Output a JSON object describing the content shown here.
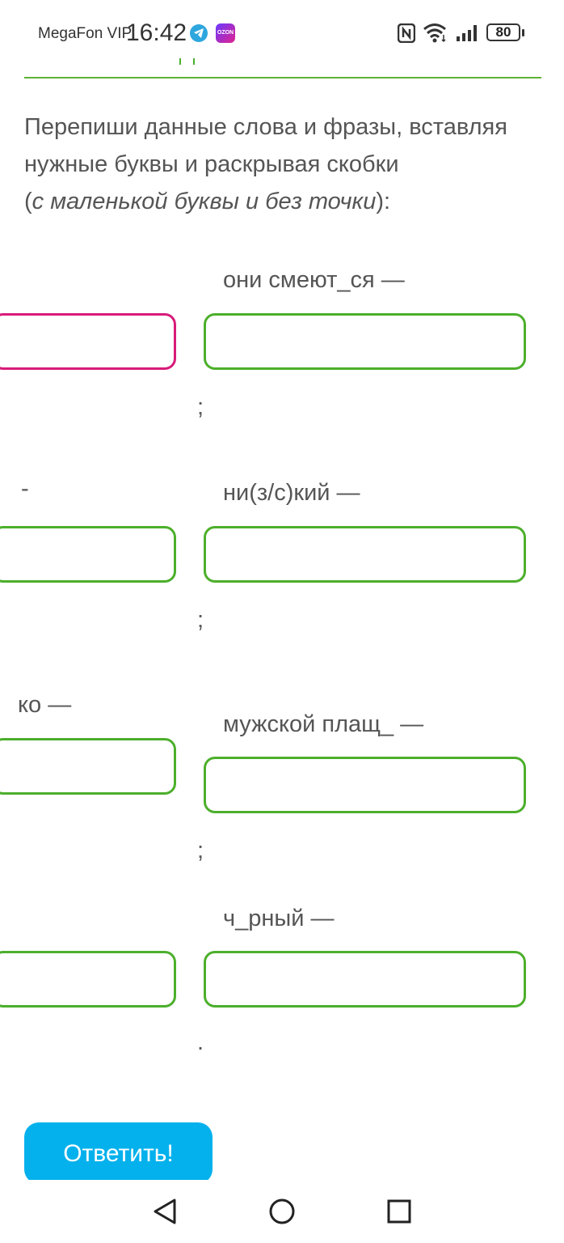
{
  "status_bar": {
    "carrier": "MegaFon VIP",
    "time": "16:42",
    "battery": "80",
    "icons": [
      "telegram-icon",
      "ozon-icon",
      "nfc-icon",
      "wifi-icon",
      "signal-icon",
      "battery-icon"
    ]
  },
  "exercise": {
    "instruction_main": "Перепиши данные слова и фразы, вставляя нужные буквы и раскрывая скобки",
    "instruction_paren_open": "(",
    "instruction_note": "с маленькой буквы и без точки",
    "instruction_paren_close": "):",
    "rows": [
      {
        "left_prompt": "",
        "left_value": "",
        "right_prompt": "они смеют_ся —",
        "right_value": "",
        "separator": ";"
      },
      {
        "left_prompt": "-",
        "left_value": "",
        "right_prompt": "ни(з/с)кий —",
        "right_value": "",
        "separator": ";"
      },
      {
        "left_prompt": "ко —",
        "left_value": "",
        "right_prompt": "мужской плащ_ —",
        "right_value": "",
        "separator": ";"
      },
      {
        "left_prompt": "",
        "left_value": "",
        "right_prompt": "ч_рный —",
        "right_value": "",
        "separator": "."
      }
    ]
  },
  "submit_label": "Ответить!",
  "colors": {
    "accent_green": "#4caf2c",
    "error_pink": "#d81b7a",
    "button_blue": "#05b1ec"
  }
}
